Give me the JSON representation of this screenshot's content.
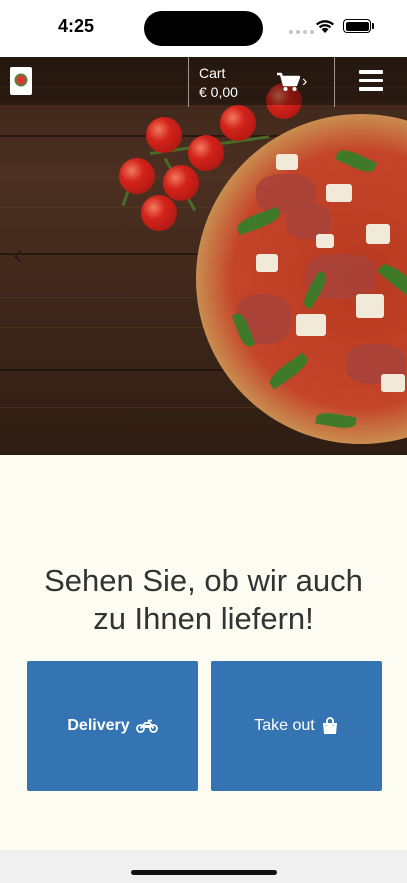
{
  "status_bar": {
    "time": "4:25",
    "icons": [
      "signal-dots-icon",
      "wifi-icon",
      "battery-icon"
    ]
  },
  "header": {
    "logo": "restaurant-logo",
    "cart": {
      "label": "Cart",
      "total": "€ 0,00",
      "icon": "shopping-cart-icon",
      "chevron": "›"
    },
    "menu_icon": "hamburger-menu-icon"
  },
  "hero": {
    "prev_arrow": "‹",
    "image": "pizza-on-wooden-table"
  },
  "main": {
    "headline_line1": "Sehen Sie, ob wir auch",
    "headline_line2": "zu Ihnen liefern!",
    "buttons": {
      "delivery_label": "Delivery",
      "delivery_icon": "motorcycle-icon",
      "takeout_label": "Take out",
      "takeout_icon": "shopping-bag-icon"
    }
  },
  "colors": {
    "accent": "#3474b3",
    "background": "#fdfcf3",
    "headline": "#333333"
  }
}
